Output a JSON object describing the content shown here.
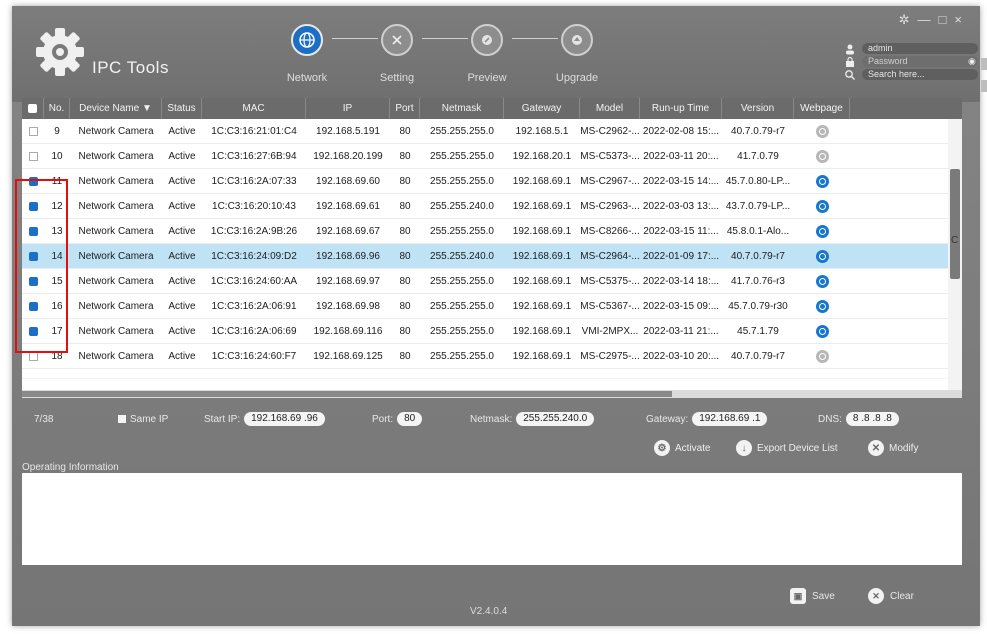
{
  "app": {
    "title": "IPC Tools",
    "version": "V2.4.0.4"
  },
  "window_controls": [
    "✲",
    "—",
    "□",
    "×"
  ],
  "steps": [
    {
      "label": "Network",
      "icon": "globe-icon",
      "active": true
    },
    {
      "label": "Setting",
      "icon": "tools-icon",
      "active": false
    },
    {
      "label": "Preview",
      "icon": "play-icon",
      "active": false
    },
    {
      "label": "Upgrade",
      "icon": "upgrade-icon",
      "active": false
    }
  ],
  "login": {
    "username": "admin",
    "password_placeholder": "Password",
    "search_placeholder": "Search here..."
  },
  "table": {
    "columns": [
      "",
      "No.",
      "Device Name ▼",
      "Status",
      "MAC",
      "IP",
      "Port",
      "Netmask",
      "Gateway",
      "Model",
      "Run-up Time",
      "Version",
      "Webpage"
    ],
    "rows": [
      {
        "checked": false,
        "no": "9",
        "name": "Network Camera",
        "status": "Active",
        "mac": "1C:C3:16:21:01:C4",
        "ip": "192.168.5.191",
        "port": "80",
        "netmask": "255.255.255.0",
        "gateway": "192.168.5.1",
        "model": "MS-C2962-...",
        "runup": "2022-02-08 15:...",
        "version": "40.7.0.79-r7",
        "web": false,
        "selected": false
      },
      {
        "checked": false,
        "no": "10",
        "name": "Network Camera",
        "status": "Active",
        "mac": "1C:C3:16:27:6B:94",
        "ip": "192.168.20.199",
        "port": "80",
        "netmask": "255.255.255.0",
        "gateway": "192.168.20.1",
        "model": "MS-C5373-...",
        "runup": "2022-03-11 20:...",
        "version": "41.7.0.79",
        "web": false,
        "selected": false
      },
      {
        "checked": true,
        "no": "11",
        "name": "Network Camera",
        "status": "Active",
        "mac": "1C:C3:16:2A:07:33",
        "ip": "192.168.69.60",
        "port": "80",
        "netmask": "255.255.255.0",
        "gateway": "192.168.69.1",
        "model": "MS-C2967-...",
        "runup": "2022-03-15 14:...",
        "version": "45.7.0.80-LP...",
        "web": true,
        "selected": false
      },
      {
        "checked": true,
        "no": "12",
        "name": "Network Camera",
        "status": "Active",
        "mac": "1C:C3:16:20:10:43",
        "ip": "192.168.69.61",
        "port": "80",
        "netmask": "255.255.240.0",
        "gateway": "192.168.69.1",
        "model": "MS-C2963-...",
        "runup": "2022-03-03 13:...",
        "version": "43.7.0.79-LP...",
        "web": true,
        "selected": false
      },
      {
        "checked": true,
        "no": "13",
        "name": "Network Camera",
        "status": "Active",
        "mac": "1C:C3:16:2A:9B:26",
        "ip": "192.168.69.67",
        "port": "80",
        "netmask": "255.255.255.0",
        "gateway": "192.168.69.1",
        "model": "MS-C8266-...",
        "runup": "2022-03-15 11:...",
        "version": "45.8.0.1-Alo...",
        "web": true,
        "selected": false
      },
      {
        "checked": true,
        "no": "14",
        "name": "Network Camera",
        "status": "Active",
        "mac": "1C:C3:16:24:09:D2",
        "ip": "192.168.69.96",
        "port": "80",
        "netmask": "255.255.240.0",
        "gateway": "192.168.69.1",
        "model": "MS-C2964-...",
        "runup": "2022-01-09 17:...",
        "version": "40.7.0.79-r7",
        "web": true,
        "selected": true
      },
      {
        "checked": true,
        "no": "15",
        "name": "Network Camera",
        "status": "Active",
        "mac": "1C:C3:16:24:60:AA",
        "ip": "192.168.69.97",
        "port": "80",
        "netmask": "255.255.255.0",
        "gateway": "192.168.69.1",
        "model": "MS-C5375-...",
        "runup": "2022-03-14 18:...",
        "version": "41.7.0.76-r3",
        "web": true,
        "selected": false
      },
      {
        "checked": true,
        "no": "16",
        "name": "Network Camera",
        "status": "Active",
        "mac": "1C:C3:16:2A:06:91",
        "ip": "192.168.69.98",
        "port": "80",
        "netmask": "255.255.255.0",
        "gateway": "192.168.69.1",
        "model": "MS-C5367-...",
        "runup": "2022-03-15 09:...",
        "version": "45.7.0.79-r30",
        "web": true,
        "selected": false
      },
      {
        "checked": true,
        "no": "17",
        "name": "Network Camera",
        "status": "Active",
        "mac": "1C:C3:16:2A:06:69",
        "ip": "192.168.69.116",
        "port": "80",
        "netmask": "255.255.255.0",
        "gateway": "192.168.69.1",
        "model": "VMI-2MPX...",
        "runup": "2022-03-11 21:...",
        "version": "45.7.1.79",
        "web": true,
        "selected": false
      },
      {
        "checked": false,
        "no": "18",
        "name": "Network Camera",
        "status": "Active",
        "mac": "1C:C3:16:24:60:F7",
        "ip": "192.168.69.125",
        "port": "80",
        "netmask": "255.255.255.0",
        "gateway": "192.168.69.1",
        "model": "MS-C2975-...",
        "runup": "2022-03-10 20:...",
        "version": "40.7.0.79-r7",
        "web": false,
        "selected": false
      }
    ]
  },
  "edge_char": "C",
  "bottom_bar": {
    "count": "7/38",
    "same_ip": "Same IP",
    "start_ip_label": "Start IP:",
    "start_ip": "192.168.69 .96",
    "port_label": "Port:",
    "port": "80",
    "netmask_label": "Netmask:",
    "netmask": "255.255.240.0",
    "gateway_label": "Gateway:",
    "gateway": "192.168.69 .1",
    "dns_label": "DNS:",
    "dns": "8 .8 .8 .8"
  },
  "actions": {
    "activate": "Activate",
    "export": "Export Device List",
    "modify": "Modify"
  },
  "operating": {
    "title": "Operating Information"
  },
  "footer": {
    "save": "Save",
    "clear": "Clear"
  },
  "colors": {
    "accent": "#1c6fc4",
    "selected_row": "#bfe3f5",
    "highlight": "#e01010"
  }
}
